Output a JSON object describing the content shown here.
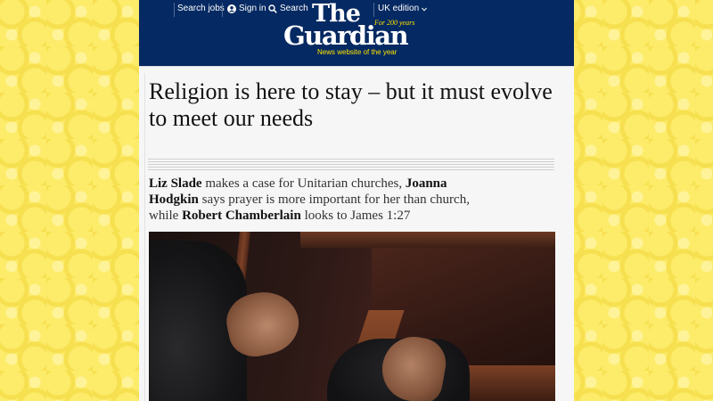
{
  "masthead": {
    "nav": {
      "search_jobs": "Search jobs",
      "sign_in": "Sign in",
      "search": "Search",
      "edition": "UK edition"
    },
    "logo_the": "The",
    "logo_guardian": "Guardian",
    "logo_badge": "For 200 years",
    "logo_tagline": "News website of the year",
    "colors": {
      "background": "#052962",
      "accent": "#ffe500"
    }
  },
  "article": {
    "headline": "Religion is here to stay – but it must evolve to meet our needs",
    "standfirst": {
      "name1": "Liz Slade",
      "text1": " makes a case for Unitarian churches, ",
      "name2": "Joanna Hodgkin",
      "text2": " says prayer is more important for her than church, while ",
      "name3": "Robert Chamberlain",
      "text3": " looks to James 1:27"
    }
  }
}
